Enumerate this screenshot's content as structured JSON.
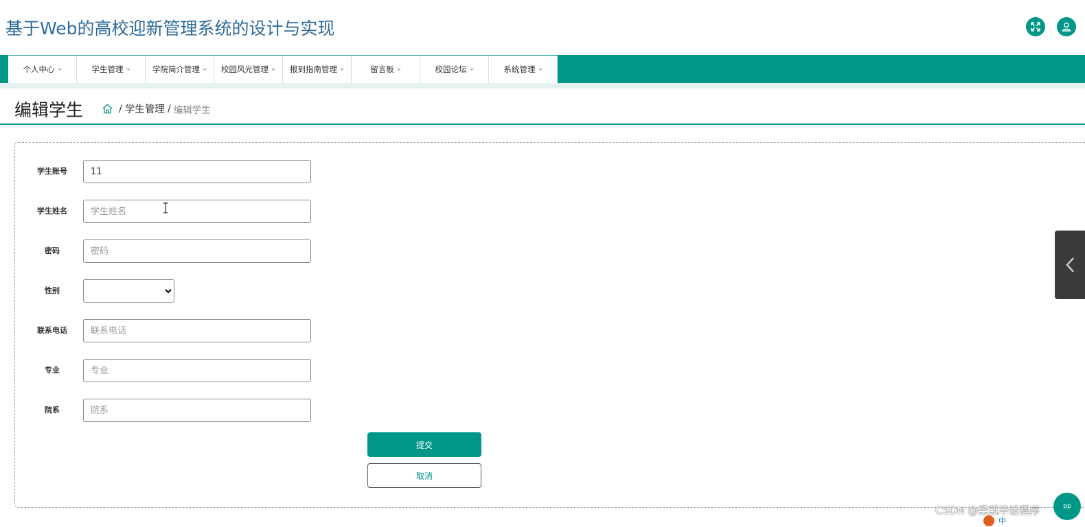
{
  "header": {
    "title": "基于Web的高校迎新管理系统的设计与实现",
    "icons": [
      "expand-icon",
      "user-icon"
    ]
  },
  "nav": {
    "items": [
      {
        "label": "个人中心"
      },
      {
        "label": "学生管理"
      },
      {
        "label": "学院简介管理"
      },
      {
        "label": "校园风光管理"
      },
      {
        "label": "报到指南管理"
      },
      {
        "label": "留言板"
      },
      {
        "label": "校园论坛"
      },
      {
        "label": "系统管理"
      }
    ]
  },
  "page": {
    "title": "编辑学生",
    "breadcrumb": {
      "sep": "/",
      "parent": "学生管理",
      "current": "编辑学生"
    }
  },
  "form": {
    "fields": [
      {
        "label": "学生账号",
        "value": "11",
        "placeholder": "学生账号"
      },
      {
        "label": "学生姓名",
        "value": "",
        "placeholder": "学生姓名"
      },
      {
        "label": "密码",
        "value": "",
        "placeholder": "密码"
      },
      {
        "label": "性别",
        "value": ""
      },
      {
        "label": "联系电话",
        "value": "",
        "placeholder": "联系电话"
      },
      {
        "label": "专业",
        "value": "",
        "placeholder": "专业"
      },
      {
        "label": "院系",
        "value": "",
        "placeholder": "院系"
      }
    ],
    "submit_label": "提交",
    "cancel_label": "取消"
  },
  "overlay": {
    "watermark": "CSDN @梁凯毕设程序",
    "help_label": "pp",
    "ime_label": "中"
  },
  "colors": {
    "accent": "#009688",
    "title": "#2f6b9a"
  }
}
